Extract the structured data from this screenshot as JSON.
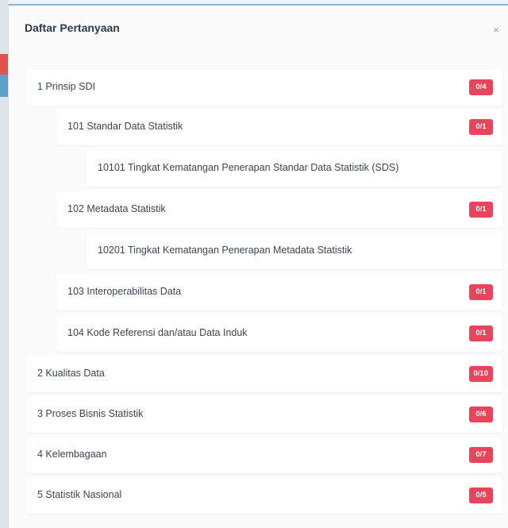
{
  "modal": {
    "title": "Daftar Pertanyaan",
    "close_glyph": "×"
  },
  "tree": [
    {
      "label": "1 Prinsip SDI",
      "badge": "0/4",
      "level": 0
    },
    {
      "label": "101 Standar Data Statistik",
      "badge": "0/1",
      "level": 1
    },
    {
      "label": "10101 Tingkat Kematangan Penerapan Standar Data Statistik (SDS)",
      "badge": "",
      "level": 2
    },
    {
      "label": "102 Metadata Statistik",
      "badge": "0/1",
      "level": 1
    },
    {
      "label": "10201 Tingkat Kematangan Penerapan Metadata Statistik",
      "badge": "",
      "level": 2
    },
    {
      "label": "103 Interoperabilitas Data",
      "badge": "0/1",
      "level": 1
    },
    {
      "label": "104 Kode Referensi dan/atau Data Induk",
      "badge": "0/1",
      "level": 1
    },
    {
      "label": "2 Kualitas Data",
      "badge": "0/10",
      "level": 0
    },
    {
      "label": "3 Proses Bisnis Statistik",
      "badge": "0/6",
      "level": 0
    },
    {
      "label": "4 Kelembagaan",
      "badge": "0/7",
      "level": 0
    },
    {
      "label": "5 Statistik Nasional",
      "badge": "0/5",
      "level": 0
    }
  ],
  "colors": {
    "badge": "#e8455d",
    "text": "#3b4654",
    "title": "#2b3a4a"
  }
}
